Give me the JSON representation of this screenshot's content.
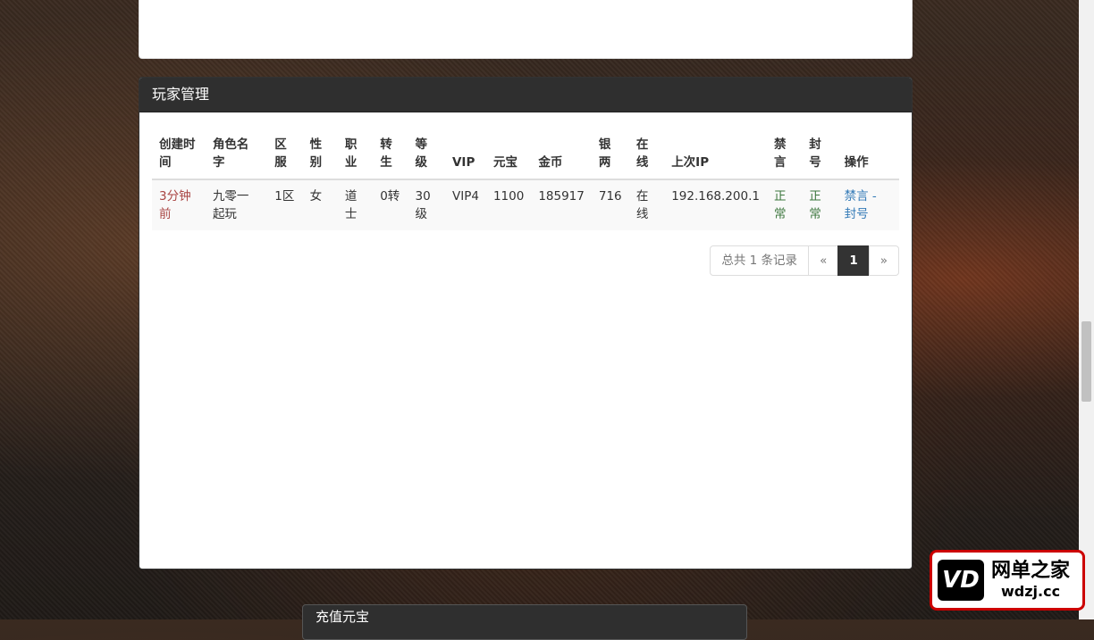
{
  "panel": {
    "title": "玩家管理"
  },
  "table": {
    "headers": [
      "创建时间",
      "角色名字",
      "区服",
      "性别",
      "职业",
      "转生",
      "等级",
      "VIP",
      "元宝",
      "金币",
      "银两",
      "在线",
      "上次IP",
      "禁言",
      "封号",
      "操作"
    ],
    "rows": [
      {
        "created": "3分钟前",
        "name": "九零一起玩",
        "server": "1区",
        "gender": "女",
        "job": "道士",
        "rebirth": "0转",
        "level": "30级",
        "vip": "VIP4",
        "yuanbao": "1100",
        "gold": "185917",
        "silver": "716",
        "online": "在线",
        "last_ip": "192.168.200.1",
        "mute": "正常",
        "ban": "正常",
        "action_mute": "禁言",
        "action_sep": " - ",
        "action_ban": "封号"
      }
    ]
  },
  "pagination": {
    "total": "总共 1 条记录",
    "prev": "«",
    "current": "1",
    "next": "»"
  },
  "next_panel": {
    "title": "充值元宝"
  },
  "watermark": {
    "brand_cn": "网单之家",
    "brand_en": "wdzj.cc",
    "mark": "VD"
  },
  "colors": {
    "heading_bg": "#2f2f2f",
    "danger_text": "#a94442",
    "success_text": "#3c763d",
    "link": "#337ab7"
  }
}
